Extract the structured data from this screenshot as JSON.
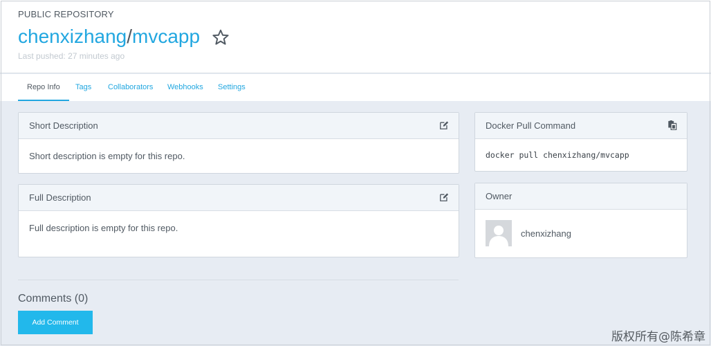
{
  "header": {
    "repo_type": "PUBLIC REPOSITORY",
    "owner": "chenxizhang",
    "separator": "/",
    "repo_name": "mvcapp",
    "star_icon": "star-outline-icon",
    "last_pushed_label": "Last pushed:",
    "last_pushed_value": "27 minutes ago"
  },
  "tabs": [
    {
      "label": "Repo Info",
      "active": true
    },
    {
      "label": "Tags",
      "active": false
    },
    {
      "label": "Collaborators",
      "active": false
    },
    {
      "label": "Webhooks",
      "active": false
    },
    {
      "label": "Settings",
      "active": false
    }
  ],
  "short_description": {
    "title": "Short Description",
    "body": "Short description is empty for this repo.",
    "icon": "edit-icon"
  },
  "full_description": {
    "title": "Full Description",
    "body": "Full description is empty for this repo.",
    "icon": "edit-icon"
  },
  "pull_command": {
    "title": "Docker Pull Command",
    "command": "docker pull chenxizhang/mvcapp",
    "icon": "clipboard-icon"
  },
  "owner_panel": {
    "title": "Owner",
    "username": "chenxizhang",
    "avatar_icon": "avatar-placeholder-icon"
  },
  "comments": {
    "title": "Comments (0)",
    "button_label": "Add Comment"
  },
  "watermark": "版权所有@陈希章",
  "colors": {
    "accent": "#22a7e0",
    "button": "#22b8eb",
    "background": "#e7ecf3",
    "text": "#505962"
  }
}
